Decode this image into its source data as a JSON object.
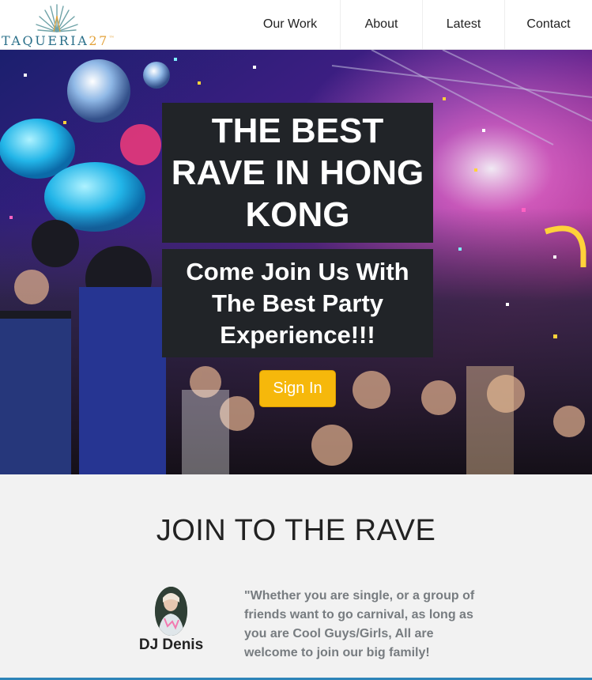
{
  "brand": {
    "name": "TAQUERIA",
    "suffix": "27",
    "mark": "™"
  },
  "nav": {
    "items": [
      {
        "label": "Our Work"
      },
      {
        "label": "About"
      },
      {
        "label": "Latest"
      },
      {
        "label": "Contact"
      }
    ]
  },
  "hero": {
    "title": "THE BEST RAVE IN HONG KONG",
    "subtitle": "Come Join Us With The Best Party Experience!!!",
    "cta_label": "Sign In"
  },
  "join": {
    "title": "JOIN TO THE RAVE",
    "testimonial": {
      "name": "DJ Denis",
      "quote": "\"Whether you are single, or a group of friends want to go carnival, as long as you are Cool Guys/Girls, All are welcome to join our big family!"
    }
  },
  "colors": {
    "accent": "#f6b80b",
    "brand_teal": "#2a6f89",
    "brand_gold": "#e3a23a",
    "overlay": "#212428",
    "section_bg": "#f2f2f2",
    "quote_text": "#777c80",
    "footer_line": "#2d84b8"
  },
  "icons": {
    "logo": "agave-leaf-icon"
  }
}
